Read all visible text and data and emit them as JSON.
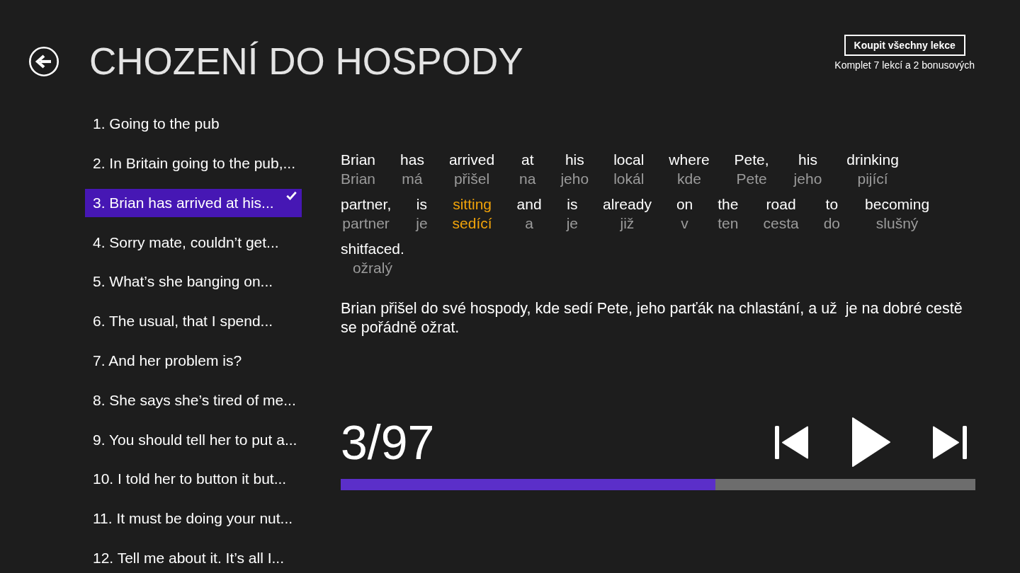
{
  "header": {
    "title": "CHOZENÍ DO HOSPODY",
    "buy_button": "Koupit všechny lekce",
    "buy_note": "Komplet 7 lekcí a 2 bonusových"
  },
  "sentences": [
    {
      "label": "1. Going to the pub",
      "selected": false
    },
    {
      "label": "2. In Britain going to the pub,...",
      "selected": false
    },
    {
      "label": "3. Brian has arrived at his...",
      "selected": true
    },
    {
      "label": "4. Sorry mate, couldn’t get...",
      "selected": false
    },
    {
      "label": "5. What’s she banging on...",
      "selected": false
    },
    {
      "label": "6. The usual, that I spend...",
      "selected": false
    },
    {
      "label": "7. And her problem is?",
      "selected": false
    },
    {
      "label": "8. She says she’s tired of me...",
      "selected": false
    },
    {
      "label": "9. You should tell her to put a...",
      "selected": false
    },
    {
      "label": "10. I told her to button it but...",
      "selected": false
    },
    {
      "label": "11. It must be doing your nut...",
      "selected": false
    },
    {
      "label": "12. Tell me about it. It’s all I...",
      "selected": false
    }
  ],
  "lesson": {
    "lines": [
      {
        "words": [
          {
            "word": "Brian",
            "gloss": "Brian",
            "selected": false
          },
          {
            "word": "has",
            "gloss": "má",
            "selected": false
          },
          {
            "word": "arrived",
            "gloss": "přišel",
            "selected": false
          },
          {
            "word": "at",
            "gloss": "na",
            "selected": false
          },
          {
            "word": "his",
            "gloss": "jeho",
            "selected": false
          },
          {
            "word": "local",
            "gloss": "lokál",
            "selected": false
          },
          {
            "word": "where",
            "gloss": "kde",
            "selected": false
          },
          {
            "word": "Pete,",
            "gloss": "Pete",
            "selected": false
          },
          {
            "word": "his",
            "gloss": "jeho",
            "selected": false
          },
          {
            "word": "drinking",
            "gloss": "pijící",
            "selected": false
          }
        ]
      },
      {
        "words": [
          {
            "word": "partner,",
            "gloss": "partner",
            "selected": false
          },
          {
            "word": "is",
            "gloss": "je",
            "selected": false
          },
          {
            "word": "sitting",
            "gloss": "sedící",
            "selected": true
          },
          {
            "word": "and",
            "gloss": "a",
            "selected": false
          },
          {
            "word": "is",
            "gloss": "je",
            "selected": false
          },
          {
            "word": "already",
            "gloss": "již",
            "selected": false
          },
          {
            "word": "on",
            "gloss": "v",
            "selected": false
          },
          {
            "word": "the",
            "gloss": "ten",
            "selected": false
          },
          {
            "word": "road",
            "gloss": "cesta",
            "selected": false
          },
          {
            "word": "to",
            "gloss": "do",
            "selected": false
          },
          {
            "word": "becoming",
            "gloss": "slušný",
            "selected": false
          }
        ]
      },
      {
        "words": [
          {
            "word": "shitfaced.",
            "gloss": "ožralý",
            "selected": false
          }
        ]
      }
    ],
    "translation": "Brian přišel do své hospody, kde sedí Pete, jeho parťák na chlastání, a už  je na dobré cestě se pořádně ožrat.",
    "counter": "3/97",
    "progress": {
      "level": 0.59
    }
  }
}
